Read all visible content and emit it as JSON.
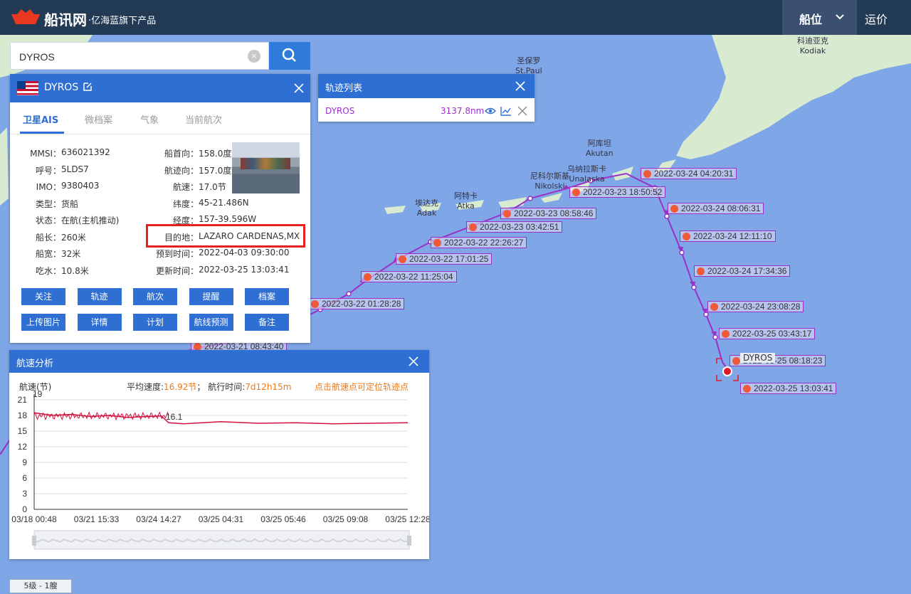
{
  "header": {
    "logo_text": "船讯网",
    "logo_sub": "·亿海蓝旗下产品",
    "nav_active": "船位",
    "nav_other": "运价"
  },
  "search": {
    "value": "DYROS",
    "clear_symbol": "×"
  },
  "ship_panel": {
    "name": "DYROS",
    "tabs": [
      "卫星AIS",
      "微档案",
      "气象",
      "当前航次"
    ],
    "left_fields": [
      {
        "label": "MMSI：",
        "value": "636021392"
      },
      {
        "label": "呼号：",
        "value": "5LDS7"
      },
      {
        "label": "IMO：",
        "value": "9380403"
      },
      {
        "label": "类型：",
        "value": "货船"
      },
      {
        "label": "状态：",
        "value": "在航(主机推动)"
      },
      {
        "label": "船长：",
        "value": "260米"
      },
      {
        "label": "船宽：",
        "value": "32米"
      },
      {
        "label": "吃水：",
        "value": "10.8米"
      }
    ],
    "right_fields": [
      {
        "label": "船首向：",
        "value": "158.0度"
      },
      {
        "label": "航迹向：",
        "value": "157.0度"
      },
      {
        "label": "航速：",
        "value": "17.0节"
      },
      {
        "label": "纬度：",
        "value": "45-21.486N"
      },
      {
        "label": "经度：",
        "value": "157-39.596W"
      },
      {
        "label": "目的地：",
        "value": "LAZARO CARDENAS,MX"
      },
      {
        "label": "预到时间：",
        "value": "2022-04-03 09:30:00"
      },
      {
        "label": "更新时间：",
        "value": "2022-03-25 13:03:41"
      }
    ],
    "buttons_row1": [
      "关注",
      "轨迹",
      "航次",
      "提醒",
      "档案"
    ],
    "buttons_row2": [
      "上传图片",
      "详情",
      "计划",
      "航线预测",
      "备注"
    ]
  },
  "track_list": {
    "title": "轨迹列表",
    "ship": "DYROS",
    "distance": "3137.8nm"
  },
  "speed_panel": {
    "title": "航速分析",
    "ylabel": "航速(节)",
    "avg_label": "平均速度:",
    "avg_value": "16.92节",
    "sep": "；",
    "time_label": "航行时间:",
    "time_value": "7d12h15m",
    "hint": "点击航速点可定位轨迹点"
  },
  "chart_data": {
    "type": "line",
    "ylabel": "航速(节)",
    "ylim": [
      0,
      21
    ],
    "yticks": [
      0,
      3,
      6,
      9,
      12,
      15,
      18,
      21
    ],
    "xticks": [
      "03/18 00:48",
      "03/21 15:33",
      "03/24 14:27",
      "03/25 04:31",
      "03/25 05:46",
      "03/25 09:08",
      "03/25 12:28"
    ],
    "annotations": [
      "19",
      "16.1"
    ],
    "series": [
      {
        "x": [
          0,
          0.05,
          0.1,
          0.15,
          0.2,
          0.25,
          0.3,
          0.34,
          0.36,
          0.4,
          0.5,
          0.6,
          0.7,
          0.8,
          0.9,
          1.0
        ],
        "values": [
          18.5,
          18.0,
          18.2,
          17.8,
          18.0,
          17.6,
          17.8,
          17.9,
          16.6,
          16.4,
          16.8,
          16.5,
          16.6,
          16.4,
          16.5,
          16.6
        ]
      }
    ]
  },
  "map": {
    "places": [
      {
        "cn": "圣保罗",
        "en": "St.Paul"
      },
      {
        "cn": "阿库坦",
        "en": "Akutan"
      },
      {
        "cn": "乌纳拉斯卡",
        "en": "Unalaska"
      },
      {
        "cn": "尼科尔斯基",
        "en": "Nikolski"
      },
      {
        "cn": "阿特卡",
        "en": "Atka"
      },
      {
        "cn": "埃达克",
        "en": "Adak"
      },
      {
        "cn": "科迪亚克",
        "en": "Kodiak"
      }
    ],
    "track_labels": [
      "2022-03-24 04:20:31",
      "2022-03-24 08:06:31",
      "2022-03-24 12:11:10",
      "2022-03-24 17:34:36",
      "2022-03-24 23:08:28",
      "2022-03-25 03:43:17",
      "2022-03-25 08:18:23",
      "2022-03-25 13:03:41",
      "2022-03-23 18:50:52",
      "2022-03-23 08:58:46",
      "2022-03-23 03:42:51",
      "2022-03-22 22:26:27",
      "2022-03-22 17:01:25",
      "2022-03-22 11:25:04",
      "2022-03-22 01:28:28",
      "2022-03-21 08:43:40"
    ],
    "ship_label": "DYROS",
    "level": "5级 - 1艘"
  },
  "colors": {
    "header": "#233a55",
    "accent": "#2f6fd3",
    "track": "#9b30c8",
    "sea": "#7fa6e6",
    "orange": "#f07a1a",
    "speed_line": "#d01040"
  }
}
